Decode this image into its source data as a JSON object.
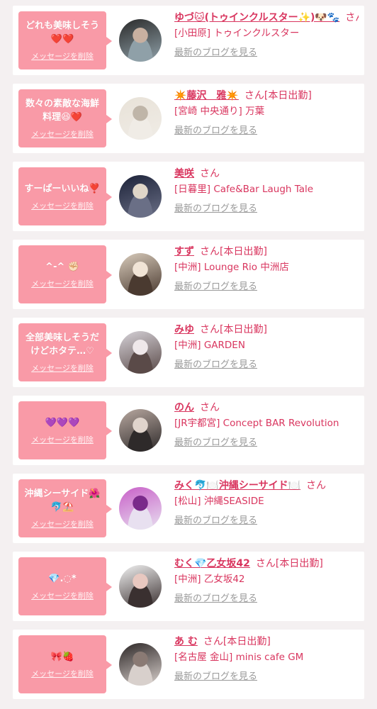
{
  "delete_label": "メッセージを削除",
  "blog_label": "最新のブログを見る",
  "messages": [
    {
      "message": "どれも美味しそう❤️❤️",
      "name": "ゆづ🐱(トゥインクルスター✨)🐶🐾",
      "suffix": "さん[本日出勤]",
      "shop": "[小田原] トゥインクルスター",
      "avatar_colors": [
        "#2a2a2a",
        "#8fa0a8",
        "#c8b0a0"
      ]
    },
    {
      "message": "数々の素敵な海鮮料理😆❤️",
      "name": "✴️藤沢　雅✴️",
      "suffix": "さん[本日出勤]",
      "shop": "[宮崎 中央通り] 万葉",
      "avatar_colors": [
        "#e8e2d8",
        "#f0ece6",
        "#bfb5a8"
      ]
    },
    {
      "message": "すーぱーいいね❣️",
      "name": "美咲",
      "suffix": "さん",
      "shop": "[日暮里] Cafe&Bar Laugh Tale",
      "avatar_colors": [
        "#1c2238",
        "#6a6f86",
        "#e0d6c8"
      ]
    },
    {
      "message": "^-^ ✊🏻",
      "name": "すず",
      "suffix": "さん[本日出勤]",
      "shop": "[中洲] Lounge Rio 中洲店",
      "avatar_colors": [
        "#d8cbbb",
        "#4a3a30",
        "#f1e4d6"
      ]
    },
    {
      "message": "全部美味しそうだけどホタテ…♡",
      "name": "みゆ",
      "suffix": "さん[本日出勤]",
      "shop": "[中洲] GARDEN",
      "avatar_colors": [
        "#d6d2d8",
        "#5a4a48",
        "#efe8ea"
      ]
    },
    {
      "message": "💜💜💜",
      "name": "のん",
      "suffix": "さん",
      "shop": "[JR宇都宮] Concept BAR Revolution",
      "avatar_colors": [
        "#b8a8a0",
        "#2e2a2a",
        "#e0d4cc"
      ]
    },
    {
      "message": "沖縄シーサイド🌺🐬⛱️",
      "name": "みく🐬🍽️沖縄シーサイド🍽️",
      "suffix": "さん",
      "shop": "[松山] 沖縄SEASIDE",
      "avatar_colors": [
        "#c860c8",
        "#e8e0f0",
        "#7a2a8a"
      ]
    },
    {
      "message": "💎.◌*",
      "name": "むく💎乙女坂42",
      "suffix": "さん[本日出勤]",
      "shop": "[中洲] 乙女坂42",
      "avatar_colors": [
        "#f2f2f2",
        "#3a3030",
        "#e8c8c0"
      ]
    },
    {
      "message": "🎀🍓",
      "name": "あ む",
      "suffix": "さん[本日出勤]",
      "shop": "[名古屋 金山] minis cafe GM",
      "avatar_colors": [
        "#2c2626",
        "#d8d0cc",
        "#8a7a74"
      ]
    }
  ]
}
